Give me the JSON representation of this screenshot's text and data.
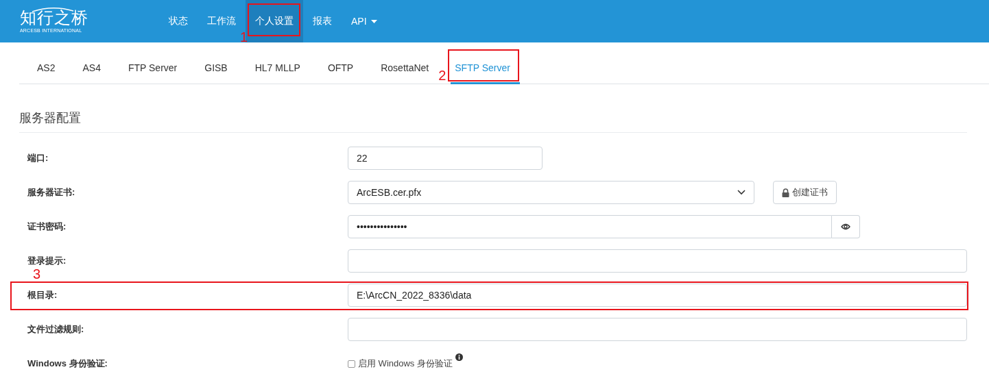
{
  "logo": {
    "title": "知行之桥",
    "subtitle": "ARCESB INTERNATIONAL"
  },
  "nav": [
    {
      "label": "状态",
      "selected": false
    },
    {
      "label": "工作流",
      "selected": false
    },
    {
      "label": "个人设置",
      "selected": true,
      "annotation": "1"
    },
    {
      "label": "报表",
      "selected": false
    },
    {
      "label": "API",
      "selected": false,
      "dropdown": true
    }
  ],
  "tabs": [
    {
      "label": "AS2",
      "selected": false
    },
    {
      "label": "AS4",
      "selected": false
    },
    {
      "label": "FTP Server",
      "selected": false
    },
    {
      "label": "GISB",
      "selected": false
    },
    {
      "label": "HL7 MLLP",
      "selected": false
    },
    {
      "label": "OFTP",
      "selected": false
    },
    {
      "label": "RosettaNet",
      "selected": false
    },
    {
      "label": "SFTP Server",
      "selected": true,
      "annotation": "2"
    }
  ],
  "section": {
    "title": "服务器配置"
  },
  "fields": [
    {
      "label": "端口:",
      "kind": "short",
      "value": "22"
    },
    {
      "label": "服务器证书:",
      "kind": "select",
      "value": "ArcESB.cer.pfx",
      "button": "创建证书"
    },
    {
      "label": "证书密码:",
      "kind": "password",
      "value": "•••••••••••••••"
    },
    {
      "label": "登录提示:",
      "kind": "text"
    },
    {
      "label": "根目录:",
      "kind": "text",
      "value": "E:\\ArcCN_2022_8336\\data",
      "annotation": "3"
    },
    {
      "label": "文件过滤规则:",
      "kind": "text"
    },
    {
      "label": "Windows 身份验证:",
      "kind": "checkbox",
      "checked": false,
      "text": "启用 Windows 身份验证"
    }
  ]
}
